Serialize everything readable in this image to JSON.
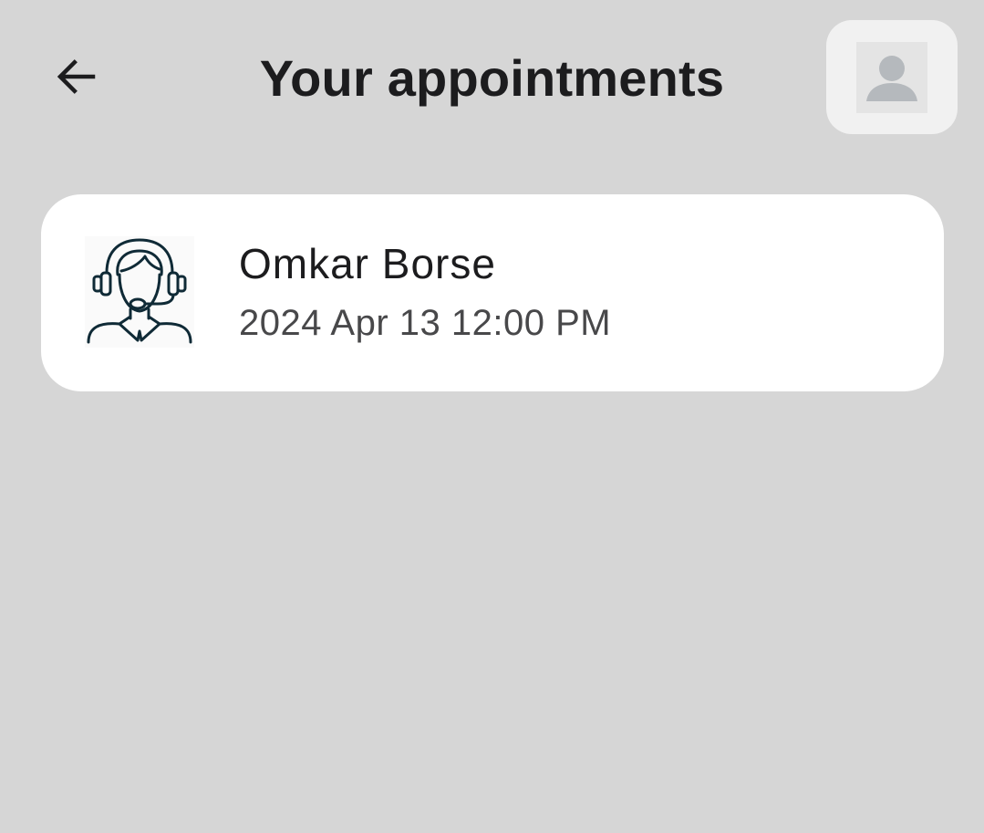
{
  "header": {
    "title": "Your appointments",
    "back_icon": "arrow-left-icon",
    "profile_icon": "user-silhouette-icon"
  },
  "appointments": [
    {
      "name": "Omkar Borse",
      "datetime": "2024 Apr 13 12:00 PM",
      "avatar_icon": "support-agent-headset-icon"
    }
  ],
  "colors": {
    "background": "#d6d6d6",
    "card": "#ffffff",
    "title_text": "#1c1c1e",
    "secondary_text": "#48484a",
    "icon_dark": "#0f2a36",
    "avatar_placeholder": "#b5b9bd"
  }
}
